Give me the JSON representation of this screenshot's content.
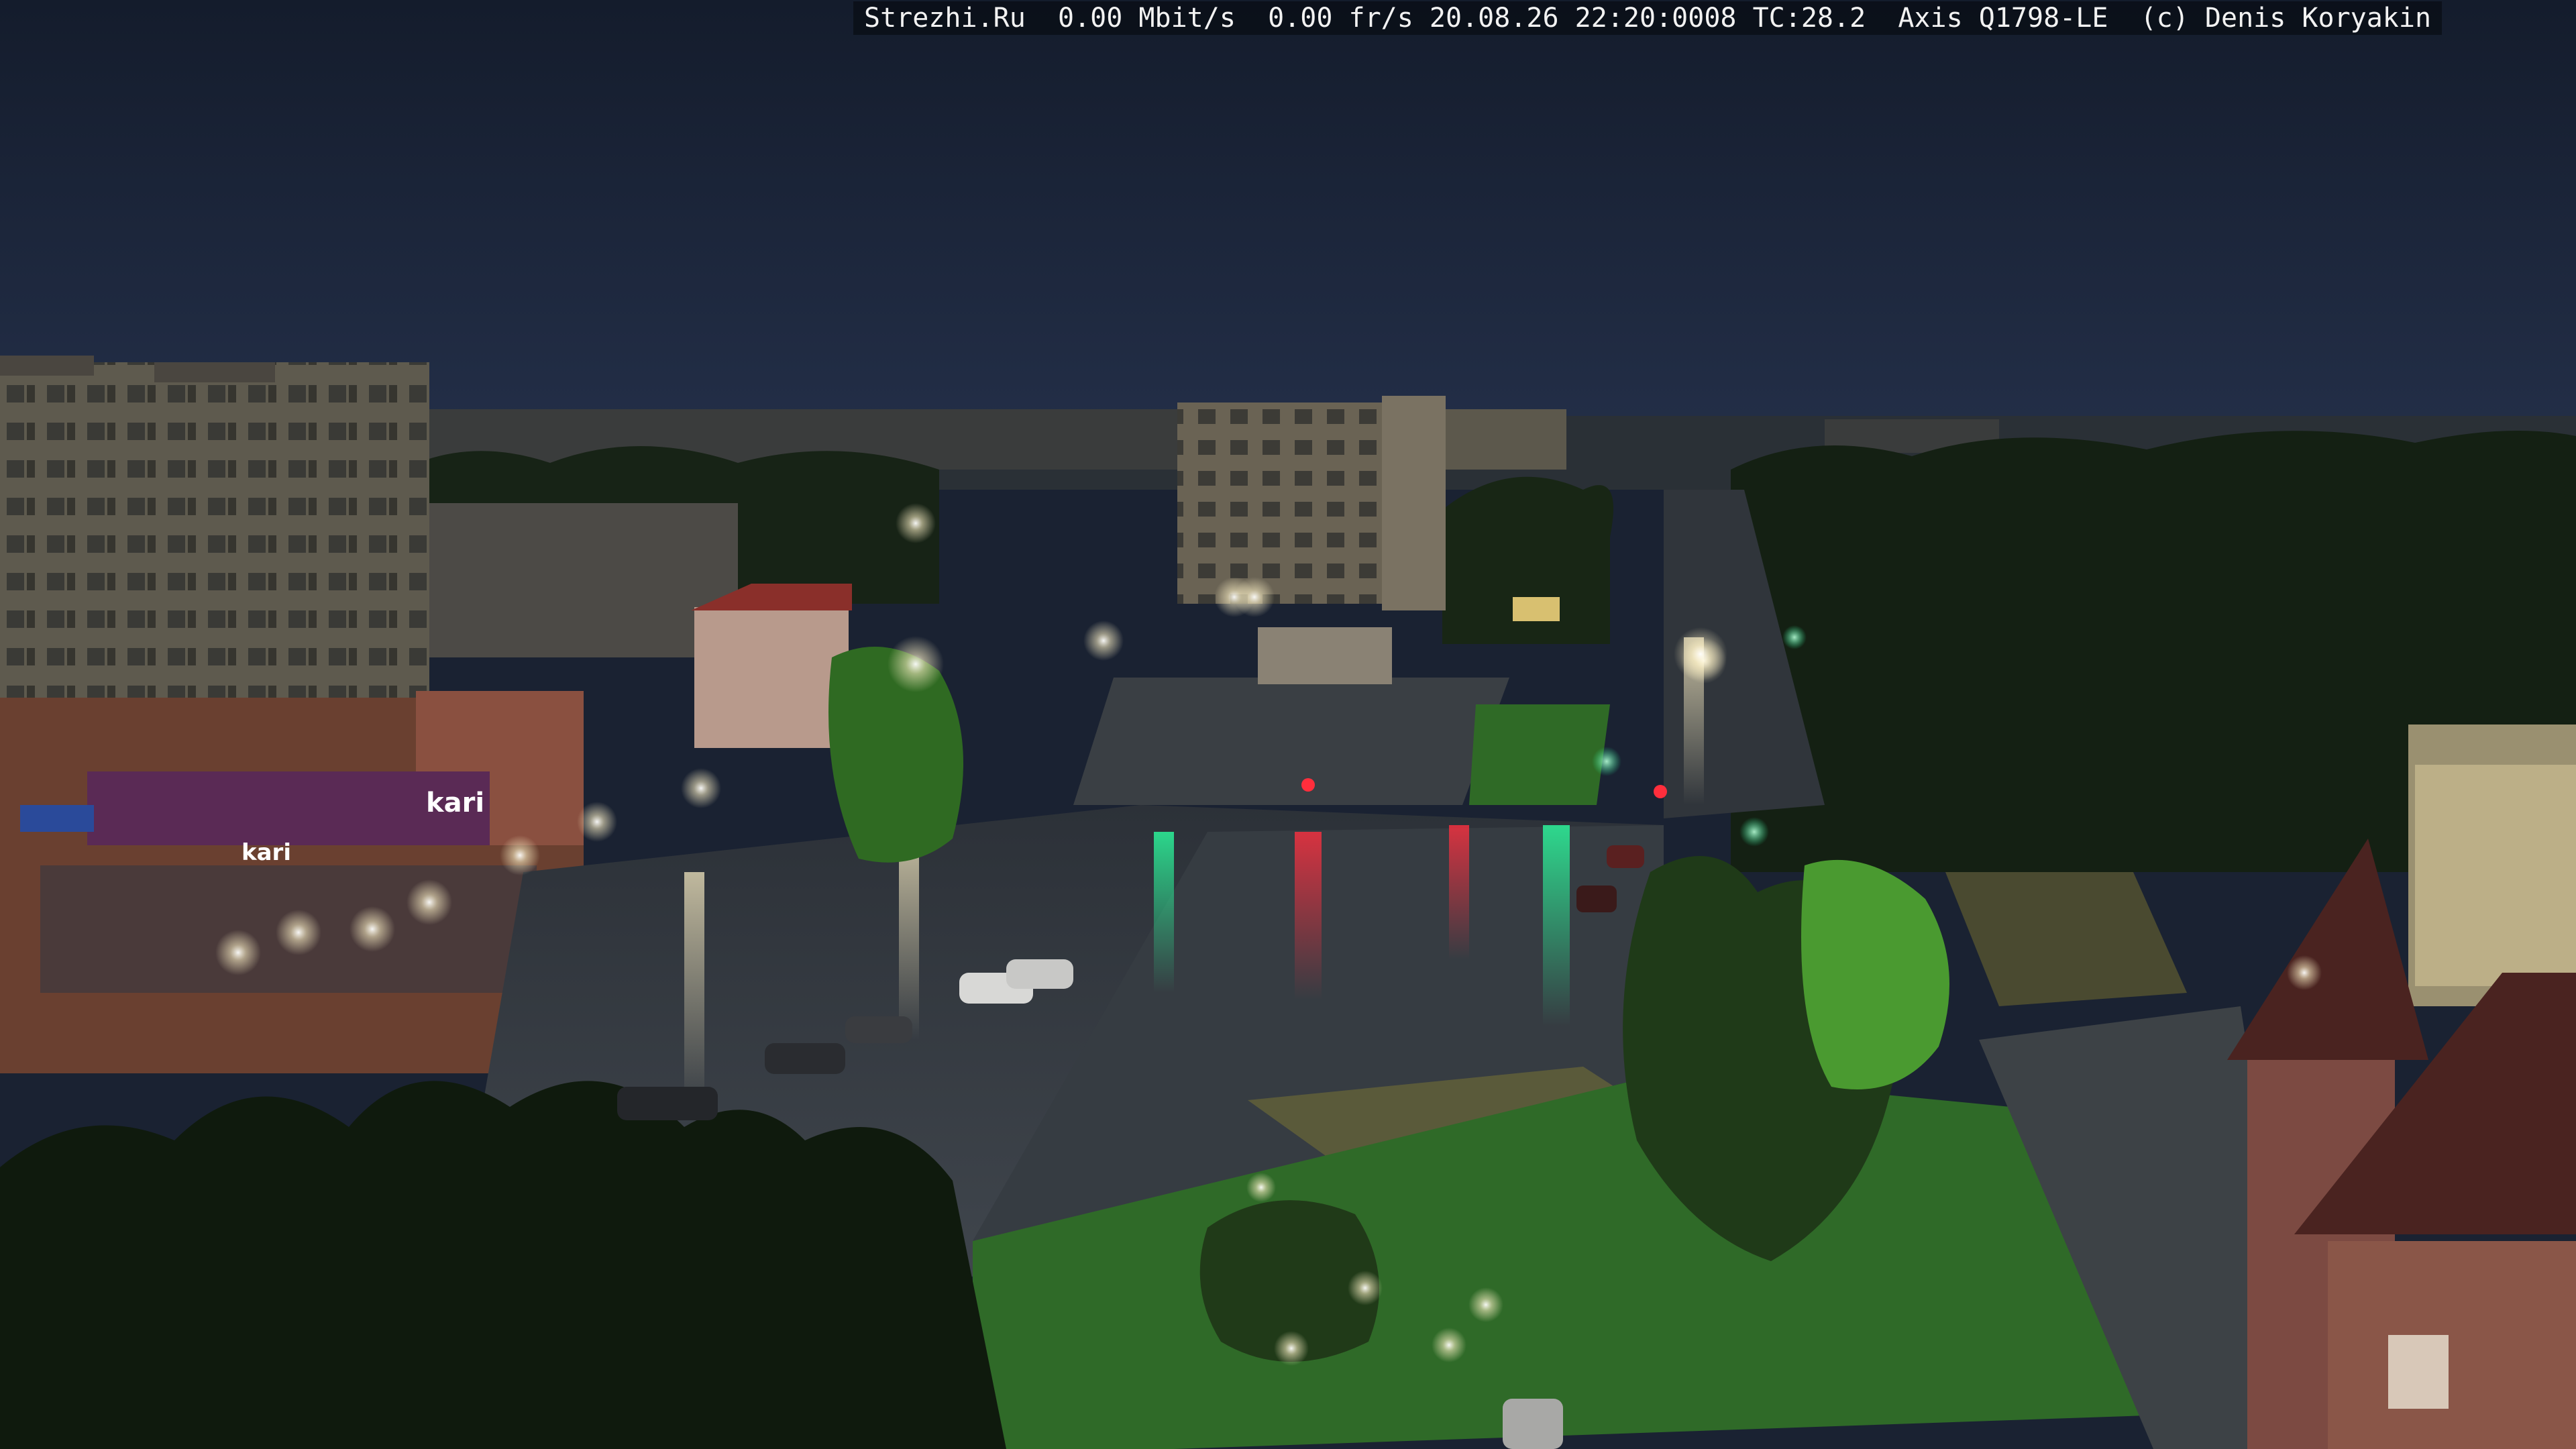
{
  "overlay": {
    "site": "Strezhi.Ru",
    "bitrate": "0.00 Mbit/s",
    "framerate": "0.00 fr/s",
    "timestamp": "20.08.26 22:20:0008",
    "tc": "TC:28.2",
    "camera": "Axis Q1798-LE",
    "copyright": "(c) Denis Koryakin"
  },
  "signage": {
    "store_logo": "kari",
    "store_logo_alt": "kari"
  },
  "colors": {
    "sky": "#1b2436",
    "wet_road": "#3a4048",
    "grass": "#3d7a2e",
    "trees_dark": "#14200f",
    "street_light": "#fff6d8",
    "traffic_green": "#1fe08a",
    "traffic_red": "#ff2e3c",
    "brick": "#8a5648",
    "roof": "#4a2320"
  }
}
